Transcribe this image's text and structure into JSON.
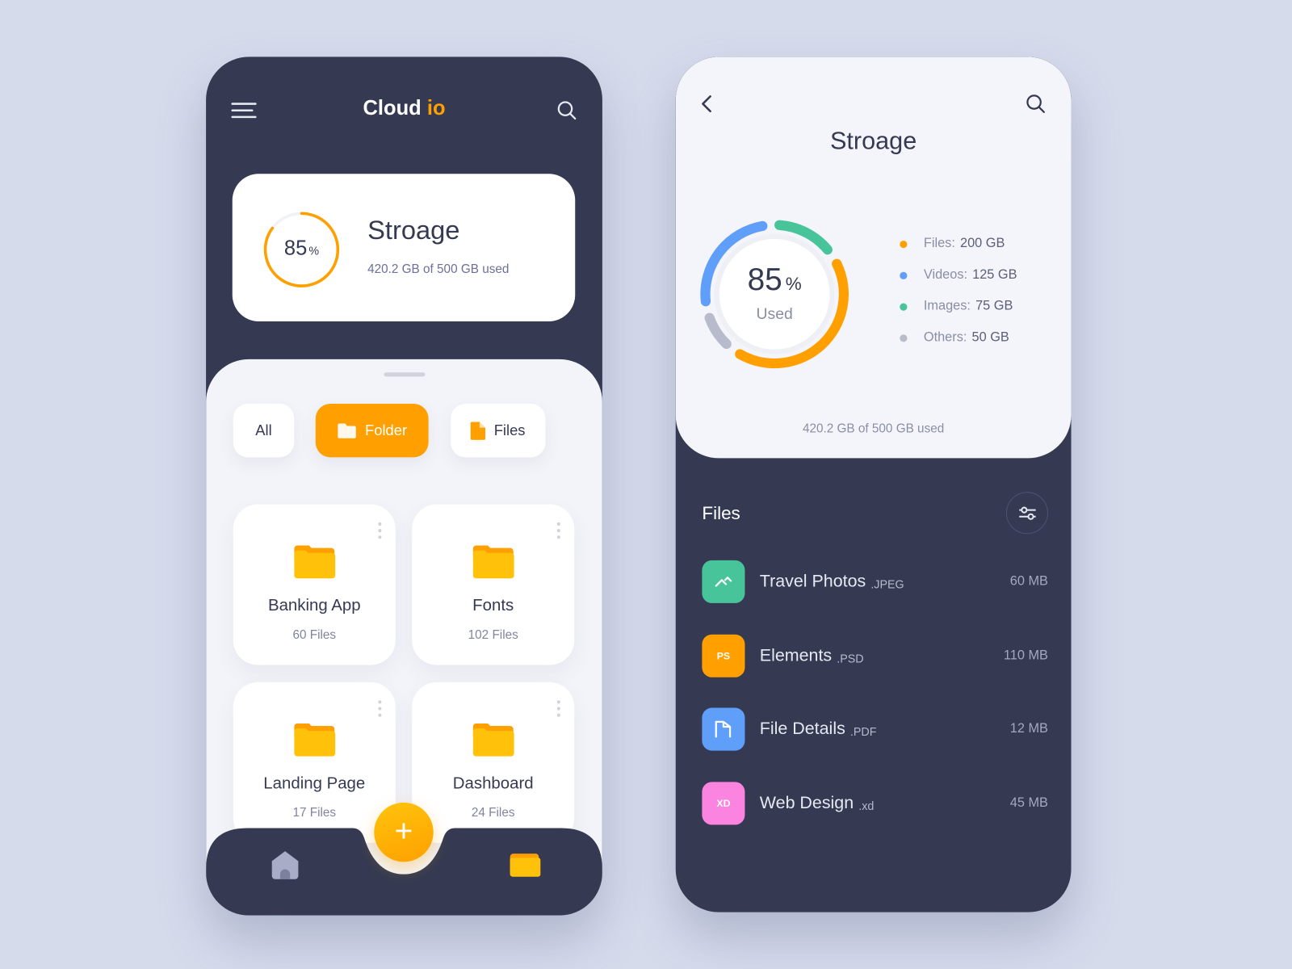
{
  "colors": {
    "accent": "#ffa000",
    "dark": "#353a52",
    "files": "#ffa000",
    "videos": "#5f9ef9",
    "images": "#48c49a",
    "others": "#b8bbcc"
  },
  "left": {
    "logo": {
      "part1": "Cl",
      "part2": "oud",
      "part3": "io"
    },
    "menu_icon": "hamburger-icon",
    "search_icon": "search-icon",
    "storage": {
      "percent": 85,
      "percent_text": "85",
      "percent_sign": "%",
      "title": "Stroage",
      "subtitle": "420.2 GB of 500 GB used"
    },
    "tabs": [
      {
        "label": "All",
        "active": false
      },
      {
        "label": "Folder",
        "active": true,
        "icon": "folder-icon"
      },
      {
        "label": "Files",
        "active": false,
        "icon": "file-icon"
      }
    ],
    "folders": [
      {
        "name": "Banking App",
        "count": "60 Files"
      },
      {
        "name": "Fonts",
        "count": "102 Files"
      },
      {
        "name": "Landing Page",
        "count": "17 Files"
      },
      {
        "name": "Dashboard",
        "count": "24 Files"
      }
    ],
    "fab_label": "+",
    "nav": [
      {
        "icon": "home-icon"
      },
      {
        "icon": "folder-icon",
        "active": true
      }
    ]
  },
  "right": {
    "title": "Stroage",
    "usage": {
      "percent_text": "85",
      "percent_sign": "%",
      "used_label": "Used",
      "footer": "420.2 GB of 500 GB used"
    },
    "legend": [
      {
        "label": "Files:",
        "value": "200 GB",
        "gb": 200,
        "color": "#ffa000"
      },
      {
        "label": "Videos:",
        "value": "125 GB",
        "gb": 125,
        "color": "#5f9ef9"
      },
      {
        "label": "Images:",
        "value": "75 GB",
        "gb": 75,
        "color": "#48c49a"
      },
      {
        "label": "Others:",
        "value": "50 GB",
        "gb": 50,
        "color": "#b8bbcc"
      }
    ],
    "files_title": "Files",
    "files": [
      {
        "name": "Travel Photos",
        "ext": ".JPEG",
        "size": "60 MB",
        "badge": "",
        "color": "#48c49a",
        "icon": "image-icon"
      },
      {
        "name": "Elements",
        "ext": ".PSD",
        "size": "110 MB",
        "badge": "PS",
        "color": "#ffa000",
        "icon": "photoshop-icon"
      },
      {
        "name": "File Details",
        "ext": ".PDF",
        "size": "12 MB",
        "badge": "",
        "color": "#5f9ef9",
        "icon": "document-icon"
      },
      {
        "name": "Web Design",
        "ext": ".xd",
        "size": "45 MB",
        "badge": "XD",
        "color": "#fb84e0",
        "icon": "xd-icon"
      }
    ]
  }
}
